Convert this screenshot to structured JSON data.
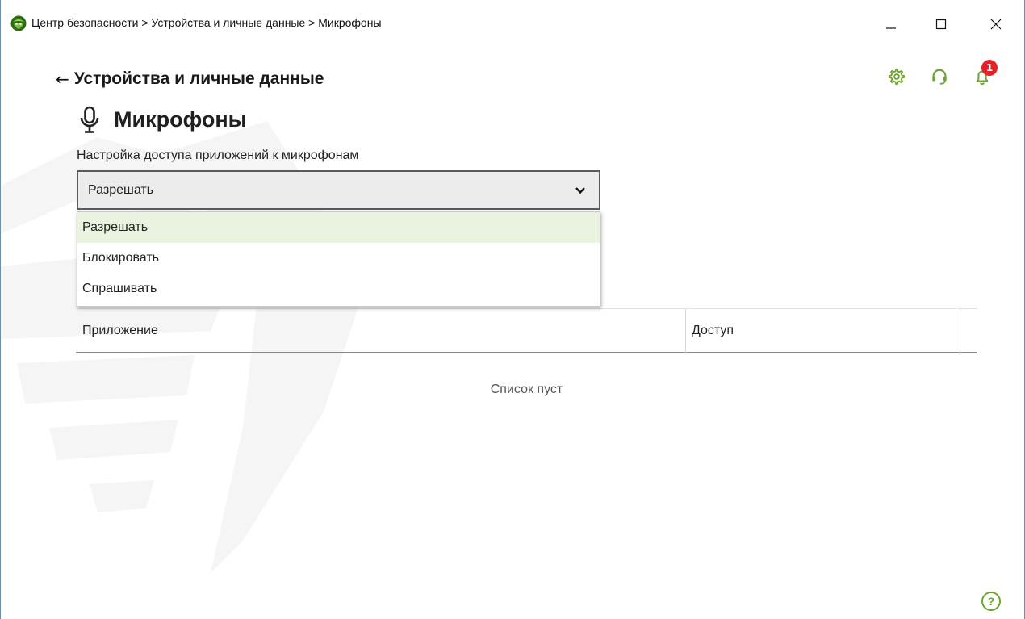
{
  "window": {
    "breadcrumb": "Центр безопасности > Устройства и личные данные > Микрофоны",
    "controls": {
      "minimize": "minimize",
      "maximize": "maximize",
      "close": "close"
    }
  },
  "header": {
    "icons": [
      "settings-gear-icon",
      "support-headset-icon",
      "notifications-bell-icon"
    ],
    "notification_count": "1",
    "accent_color": "#6aa62e",
    "badge_color": "#e3222a"
  },
  "nav": {
    "back_arrow": "←",
    "back_label": "Устройства и личные данные"
  },
  "page": {
    "title": "Микрофоны",
    "setting_label": "Настройка доступа приложений к микрофонам"
  },
  "access_select": {
    "selected": "Разрешать",
    "options": [
      "Разрешать",
      "Блокировать",
      "Спрашивать"
    ]
  },
  "table": {
    "columns": [
      "Приложение",
      "Доступ"
    ],
    "empty_text": "Список пуст"
  },
  "help": {
    "label": "?"
  }
}
